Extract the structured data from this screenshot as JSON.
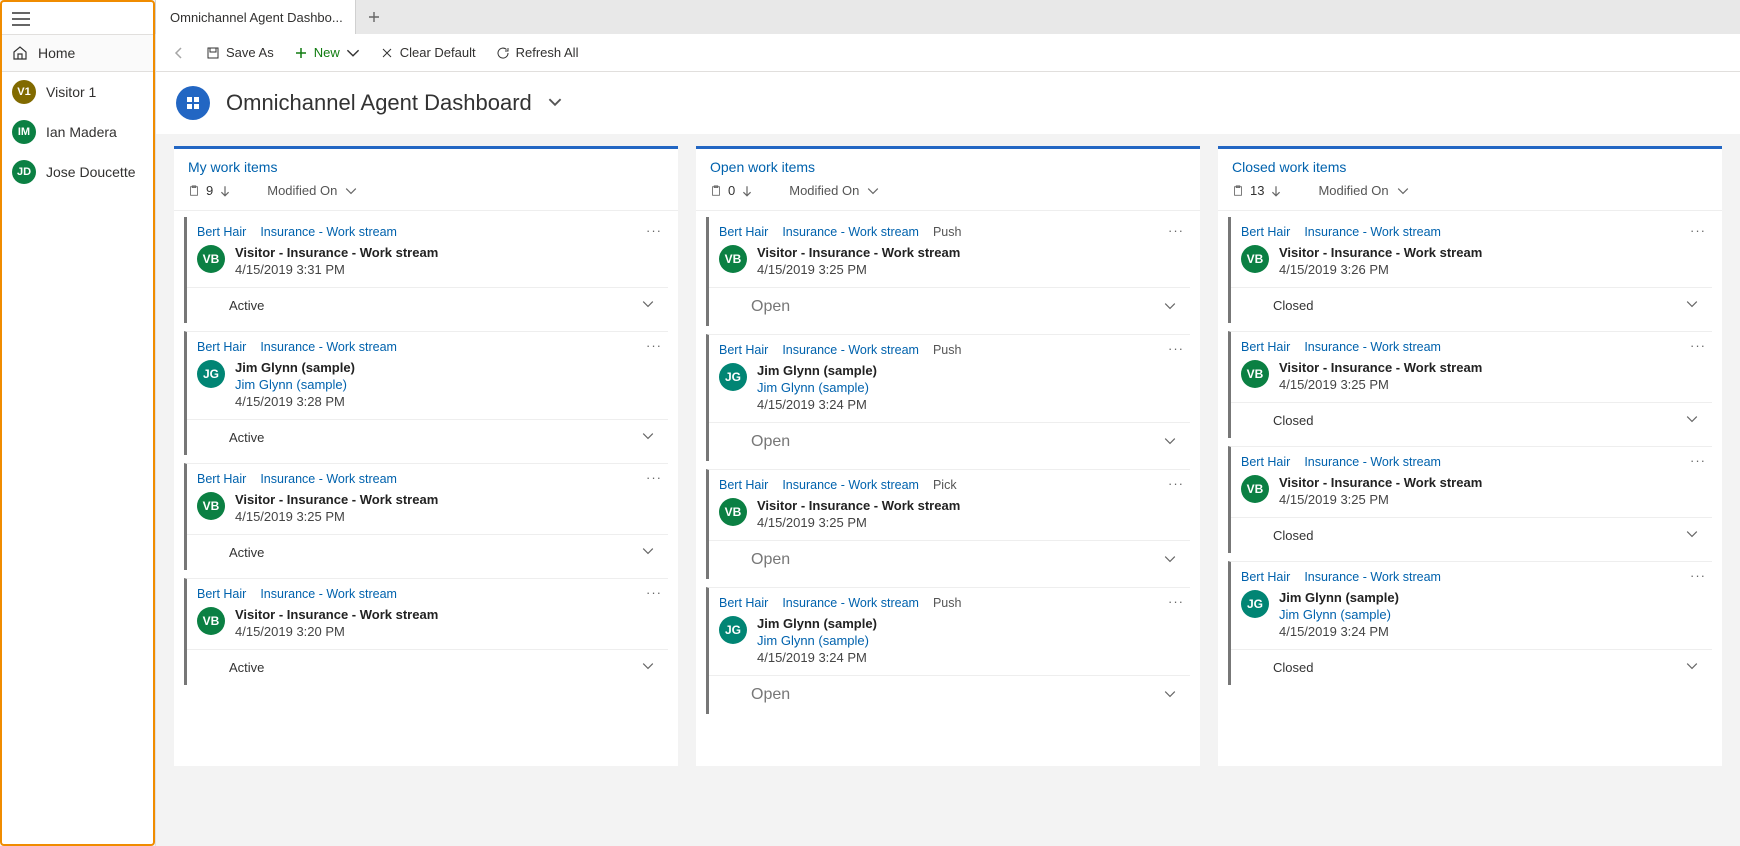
{
  "sidebar": {
    "home_label": "Home",
    "items": [
      {
        "initials": "V1",
        "name": "Visitor 1",
        "color": "bg-olive"
      },
      {
        "initials": "IM",
        "name": "Ian Madera",
        "color": "bg-green"
      },
      {
        "initials": "JD",
        "name": "Jose Doucette",
        "color": "bg-green2"
      }
    ]
  },
  "tabs": {
    "active": "Omnichannel Agent Dashbo..."
  },
  "toolbar": {
    "save_as": "Save As",
    "new": "New",
    "clear_default": "Clear Default",
    "refresh_all": "Refresh All"
  },
  "header": {
    "title": "Omnichannel Agent Dashboard"
  },
  "columns": [
    {
      "title": "My work items",
      "count": "9",
      "sort": "Modified On",
      "cards": [
        {
          "author": "Bert Hair",
          "stream": "Insurance - Work stream",
          "avatar": "VB",
          "avColor": "bg-green",
          "title": "Visitor - Insurance - Work stream",
          "link": "",
          "stamp": "4/15/2019 3:31 PM",
          "status": "Active",
          "statusOpen": false
        },
        {
          "author": "Bert Hair",
          "stream": "Insurance - Work stream",
          "avatar": "JG",
          "avColor": "bg-teal",
          "title": "Jim Glynn (sample)",
          "link": "Jim Glynn (sample)",
          "stamp": "4/15/2019 3:28 PM",
          "status": "Active",
          "statusOpen": false
        },
        {
          "author": "Bert Hair",
          "stream": "Insurance - Work stream",
          "avatar": "VB",
          "avColor": "bg-green",
          "title": "Visitor - Insurance - Work stream",
          "link": "",
          "stamp": "4/15/2019 3:25 PM",
          "status": "Active",
          "statusOpen": false
        },
        {
          "author": "Bert Hair",
          "stream": "Insurance - Work stream",
          "avatar": "VB",
          "avColor": "bg-green",
          "title": "Visitor - Insurance - Work stream",
          "link": "",
          "stamp": "4/15/2019 3:20 PM",
          "status": "Active",
          "statusOpen": false
        }
      ]
    },
    {
      "title": "Open work items",
      "count": "0",
      "sort": "Modified On",
      "cards": [
        {
          "author": "Bert Hair",
          "stream": "Insurance - Work stream",
          "tag": "Push",
          "avatar": "VB",
          "avColor": "bg-green",
          "title": "Visitor - Insurance - Work stream",
          "link": "",
          "stamp": "4/15/2019 3:25 PM",
          "status": "Open",
          "statusOpen": true
        },
        {
          "author": "Bert Hair",
          "stream": "Insurance - Work stream",
          "tag": "Push",
          "avatar": "JG",
          "avColor": "bg-teal",
          "title": "Jim Glynn (sample)",
          "link": "Jim Glynn (sample)",
          "stamp": "4/15/2019 3:24 PM",
          "status": "Open",
          "statusOpen": true
        },
        {
          "author": "Bert Hair",
          "stream": "Insurance - Work stream",
          "tag": "Pick",
          "avatar": "VB",
          "avColor": "bg-green",
          "title": "Visitor - Insurance - Work stream",
          "link": "",
          "stamp": "4/15/2019 3:25 PM",
          "status": "Open",
          "statusOpen": true
        },
        {
          "author": "Bert Hair",
          "stream": "Insurance - Work stream",
          "tag": "Push",
          "avatar": "JG",
          "avColor": "bg-teal",
          "title": "Jim Glynn (sample)",
          "link": "Jim Glynn (sample)",
          "stamp": "4/15/2019 3:24 PM",
          "status": "Open",
          "statusOpen": true
        }
      ]
    },
    {
      "title": "Closed work items",
      "count": "13",
      "sort": "Modified On",
      "cards": [
        {
          "author": "Bert Hair",
          "stream": "Insurance - Work stream",
          "avatar": "VB",
          "avColor": "bg-green",
          "title": "Visitor - Insurance - Work stream",
          "link": "",
          "stamp": "4/15/2019 3:26 PM",
          "status": "Closed",
          "statusOpen": false
        },
        {
          "author": "Bert Hair",
          "stream": "Insurance - Work stream",
          "avatar": "VB",
          "avColor": "bg-green",
          "title": "Visitor - Insurance - Work stream",
          "link": "",
          "stamp": "4/15/2019 3:25 PM",
          "status": "Closed",
          "statusOpen": false
        },
        {
          "author": "Bert Hair",
          "stream": "Insurance - Work stream",
          "avatar": "VB",
          "avColor": "bg-green",
          "title": "Visitor - Insurance - Work stream",
          "link": "",
          "stamp": "4/15/2019 3:25 PM",
          "status": "Closed",
          "statusOpen": false
        },
        {
          "author": "Bert Hair",
          "stream": "Insurance - Work stream",
          "avatar": "JG",
          "avColor": "bg-teal",
          "title": "Jim Glynn (sample)",
          "link": "Jim Glynn (sample)",
          "stamp": "4/15/2019 3:24 PM",
          "status": "Closed",
          "statusOpen": false
        }
      ]
    }
  ]
}
